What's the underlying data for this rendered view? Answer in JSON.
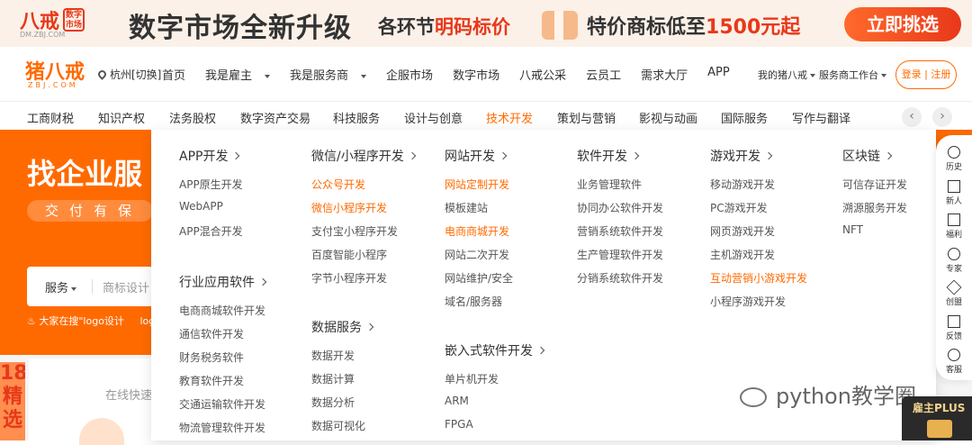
{
  "banner": {
    "logo": "八戒",
    "seal": "数字市场",
    "logo_sub": "DM.ZBJ.COM",
    "headline": "数字市场全新升级",
    "middle_prefix": "各环节",
    "middle_highlight": "明码标价",
    "price_prefix": "特价商标低至",
    "price_highlight": "1500元起",
    "cta": "立即挑选"
  },
  "header": {
    "brand": "猪八戒",
    "brand_en": "ZBJ.COM",
    "city": "杭州[切换]",
    "nav": [
      {
        "label": "首页",
        "dropdown": false
      },
      {
        "label": "我是雇主",
        "dropdown": true
      },
      {
        "label": "我是服务商",
        "dropdown": true
      },
      {
        "label": "企服市场",
        "dropdown": false
      },
      {
        "label": "数字市场",
        "dropdown": false
      },
      {
        "label": "八戒公采",
        "dropdown": false
      },
      {
        "label": "云员工",
        "dropdown": false
      },
      {
        "label": "需求大厅",
        "dropdown": false
      },
      {
        "label": "APP",
        "dropdown": false
      }
    ],
    "my_zbj": "我的猪八戒",
    "workbench": "服务商工作台",
    "login": "登录",
    "separator": "|",
    "register": "注册"
  },
  "categories": {
    "tabs": [
      "工商财税",
      "知识产权",
      "法务股权",
      "数字资产交易",
      "科技服务",
      "设计与创意",
      "技术开发",
      "策划与营销",
      "影视与动画",
      "国际服务",
      "写作与翻译"
    ],
    "active": "技术开发",
    "prev_icon": "‹",
    "next_icon": "›"
  },
  "hero": {
    "title": "找企业服",
    "slogan": "交付有保",
    "search_type": "服务",
    "search_placeholder": "商标设计",
    "hot_prefix": "大家在搜\"logo设计",
    "hot_next": "log"
  },
  "lower": {
    "tip": "在线快速",
    "side_promo": "18 精选"
  },
  "mega_menu": {
    "columns": [
      {
        "sections": [
          {
            "title": "APP开发",
            "items": [
              {
                "label": "APP原生开发",
                "hot": false
              },
              {
                "label": "WebAPP",
                "hot": false
              },
              {
                "label": "APP混合开发",
                "hot": false
              }
            ]
          },
          {
            "title": "行业应用软件",
            "items": [
              {
                "label": "电商商城软件开发",
                "hot": false
              },
              {
                "label": "通信软件开发",
                "hot": false
              },
              {
                "label": "财务税务软件",
                "hot": false
              },
              {
                "label": "教育软件开发",
                "hot": false
              },
              {
                "label": "交通运输软件开发",
                "hot": false
              },
              {
                "label": "物流管理软件开发",
                "hot": false
              }
            ]
          }
        ]
      },
      {
        "sections": [
          {
            "title": "微信/小程序开发",
            "items": [
              {
                "label": "公众号开发",
                "hot": true
              },
              {
                "label": "微信小程序开发",
                "hot": true
              },
              {
                "label": "支付宝小程序开发",
                "hot": false
              },
              {
                "label": "百度智能小程序",
                "hot": false
              },
              {
                "label": "字节小程序开发",
                "hot": false
              }
            ]
          },
          {
            "title": "数据服务",
            "items": [
              {
                "label": "数据开发",
                "hot": false
              },
              {
                "label": "数据计算",
                "hot": false
              },
              {
                "label": "数据分析",
                "hot": false
              },
              {
                "label": "数据可视化",
                "hot": false
              }
            ]
          }
        ]
      },
      {
        "sections": [
          {
            "title": "网站开发",
            "items": [
              {
                "label": "网站定制开发",
                "hot": true
              },
              {
                "label": "模板建站",
                "hot": false
              },
              {
                "label": "电商商城开发",
                "hot": true
              },
              {
                "label": "网站二次开发",
                "hot": false
              },
              {
                "label": "网站维护/安全",
                "hot": false
              },
              {
                "label": "域名/服务器",
                "hot": false
              }
            ]
          },
          {
            "title": "嵌入式软件开发",
            "items": [
              {
                "label": "单片机开发",
                "hot": false
              },
              {
                "label": "ARM",
                "hot": false
              },
              {
                "label": "FPGA",
                "hot": false
              }
            ]
          }
        ]
      },
      {
        "sections": [
          {
            "title": "软件开发",
            "items": [
              {
                "label": "业务管理软件",
                "hot": false
              },
              {
                "label": "协同办公软件开发",
                "hot": false
              },
              {
                "label": "营销系统软件开发",
                "hot": false
              },
              {
                "label": "生产管理软件开发",
                "hot": false
              },
              {
                "label": "分销系统软件开发",
                "hot": false
              }
            ]
          }
        ]
      },
      {
        "sections": [
          {
            "title": "游戏开发",
            "items": [
              {
                "label": "移动游戏开发",
                "hot": false
              },
              {
                "label": "PC游戏开发",
                "hot": false
              },
              {
                "label": "网页游戏开发",
                "hot": false
              },
              {
                "label": "主机游戏开发",
                "hot": false
              },
              {
                "label": "互动营销小游戏开发",
                "hot": true
              },
              {
                "label": "小程序游戏开发",
                "hot": false
              }
            ]
          }
        ]
      },
      {
        "sections": [
          {
            "title": "区块链",
            "items": [
              {
                "label": "可信存证开发",
                "hot": false
              },
              {
                "label": "溯源服务开发",
                "hot": false
              },
              {
                "label": "NFT",
                "hot": false
              }
            ]
          }
        ]
      }
    ]
  },
  "right_rail": [
    {
      "label": "历史",
      "icon": "clock-icon"
    },
    {
      "label": "新人",
      "icon": "newbie-icon"
    },
    {
      "label": "福利",
      "icon": "gift-icon"
    },
    {
      "label": "专家",
      "icon": "expert-icon"
    },
    {
      "label": "创盟",
      "icon": "cube-icon"
    },
    {
      "label": "反馈",
      "icon": "feedback-icon"
    },
    {
      "label": "客服",
      "icon": "headset-icon"
    }
  ],
  "watermark": "python教学圈",
  "badge": "雇主PLUS",
  "colors": {
    "accent": "#ff6a00",
    "brand_red": "#e8381a"
  }
}
